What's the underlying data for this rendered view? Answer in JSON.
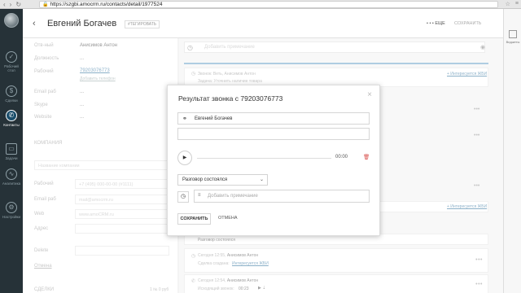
{
  "browser": {
    "url": "https://szgbi.amocrm.ru/contacts/detail/1977524",
    "secure_icon": "lock-icon"
  },
  "sidebar": {
    "items": [
      {
        "label": "Рабочий стол",
        "icon": "dashboard-icon"
      },
      {
        "label": "Сделки",
        "icon": "deals-icon"
      },
      {
        "label": "Контакты",
        "icon": "contacts-icon"
      },
      {
        "label": "Задачи",
        "icon": "tasks-icon"
      },
      {
        "label": "Аналитика",
        "icon": "analytics-icon"
      },
      {
        "label": "Настройки",
        "icon": "settings-icon"
      }
    ]
  },
  "right_sidebar": {
    "widgets_label": "Виджеты"
  },
  "header": {
    "name": "Евгений Богачев",
    "tag_button": "#ТЕГИРОВАТЬ",
    "more_button": "• • • ЕЩЕ",
    "save_button": "СОХРАНИТЬ"
  },
  "info": {
    "fields": [
      {
        "label": "Отв-ный",
        "value": "Анисимов Антон"
      },
      {
        "label": "Должность",
        "value": "..."
      },
      {
        "label": "Рабочий",
        "value": "79203076773",
        "sub": "Добавить телефон"
      },
      {
        "label": "Email раб",
        "value": "..."
      },
      {
        "label": "Skype",
        "value": "..."
      },
      {
        "label": "Website",
        "value": "..."
      }
    ],
    "company_section": "КОМПАНИЯ",
    "company_name_placeholder": "Название компании",
    "company_fields": [
      {
        "label": "Рабочий",
        "placeholder": "+7 (495) 000-00-00 (#1111)"
      },
      {
        "label": "Email раб",
        "placeholder": "mail@amocrm.ru"
      },
      {
        "label": "Web",
        "placeholder": "www.amoCRM.ru"
      },
      {
        "label": "Адрес",
        "placeholder": ""
      },
      {
        "label": "Delete",
        "placeholder": ""
      }
    ],
    "cancel_link": "Отмена",
    "deals_label": "СДЕЛКИ",
    "deals_summary": "1 № 0 руб"
  },
  "feed": {
    "note_placeholder": "Добавить примечание",
    "items": [
      {
        "text": "Звонок: Веть, Анисимов Антон",
        "link": "+ Интересуется ЖБИ"
      },
      {
        "text": "Задача: Уточнить наличие товара",
        "link": ""
      },
      {
        "text": "Сделка создана",
        "link": "+ Интересуется ЖБИ"
      },
      {
        "text": "Разговор состоялся",
        "link": ""
      },
      {
        "meta": "Сегодня 12:55,",
        "author": "Анисимов Антон",
        "text": "Сделка создана:",
        "link": "Интересуется ЖБИ"
      },
      {
        "meta": "Сегодня 12:54,",
        "author": "Анисимов Антон",
        "text": "Исходящий звонок:",
        "link": "00:23"
      }
    ]
  },
  "modal": {
    "title": "Результат звонка с 79203076773",
    "contact_value": "Евгений Богачев",
    "second_input_value": "",
    "time": "00:00",
    "select_value": "Разговор состоялся",
    "note_placeholder": "Добавить примечание",
    "save_label": "СОХРАНИТЬ",
    "cancel_label": "ОТМЕНА"
  }
}
